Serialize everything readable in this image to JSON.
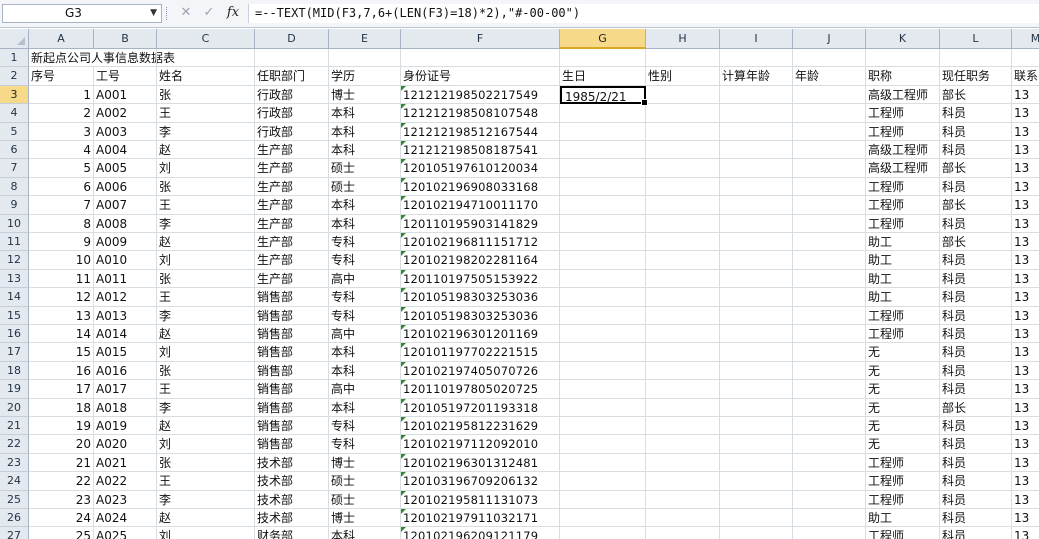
{
  "formula_bar": {
    "name_box": "G3",
    "formula": "=--TEXT(MID(F3,7,6+(LEN(F3)=18)*2),\"#-00-00\")"
  },
  "columns": [
    "A",
    "B",
    "C",
    "D",
    "E",
    "F",
    "G",
    "H",
    "I",
    "J",
    "K",
    "L",
    "M"
  ],
  "selected_column": "G",
  "row1_title": "新起点公司人事信息数据表",
  "headers": [
    "序号",
    "工号",
    "姓名",
    "任职部门",
    "学历",
    "身份证号",
    "生日",
    "性别",
    "计算年龄",
    "年龄",
    "职称",
    "现任职务",
    "联系"
  ],
  "active_cell_value": "1985/2/21",
  "rows": [
    {
      "r": "3",
      "seq": "1",
      "id": "A001",
      "name": "张",
      "dept": "行政部",
      "edu": "博士",
      "idno": "121212198502217549",
      "title": "高级工程师",
      "pos": "部长",
      "tel": "13"
    },
    {
      "r": "4",
      "seq": "2",
      "id": "A002",
      "name": "王",
      "dept": "行政部",
      "edu": "本科",
      "idno": "121212198508107548",
      "title": "工程师",
      "pos": "科员",
      "tel": "13"
    },
    {
      "r": "5",
      "seq": "3",
      "id": "A003",
      "name": "李",
      "dept": "行政部",
      "edu": "本科",
      "idno": "121212198512167544",
      "title": "工程师",
      "pos": "科员",
      "tel": "13"
    },
    {
      "r": "6",
      "seq": "4",
      "id": "A004",
      "name": "赵",
      "dept": "生产部",
      "edu": "本科",
      "idno": "121212198508187541",
      "title": "高级工程师",
      "pos": "科员",
      "tel": "13"
    },
    {
      "r": "7",
      "seq": "5",
      "id": "A005",
      "name": "刘",
      "dept": "生产部",
      "edu": "硕士",
      "idno": "120105197610120034",
      "title": "高级工程师",
      "pos": "部长",
      "tel": "13"
    },
    {
      "r": "8",
      "seq": "6",
      "id": "A006",
      "name": "张",
      "dept": "生产部",
      "edu": "硕士",
      "idno": "120102196908033168",
      "title": "工程师",
      "pos": "科员",
      "tel": "13"
    },
    {
      "r": "9",
      "seq": "7",
      "id": "A007",
      "name": "王",
      "dept": "生产部",
      "edu": "本科",
      "idno": "120102194710011170",
      "title": "工程师",
      "pos": "部长",
      "tel": "13"
    },
    {
      "r": "10",
      "seq": "8",
      "id": "A008",
      "name": "李",
      "dept": "生产部",
      "edu": "本科",
      "idno": "120110195903141829",
      "title": "工程师",
      "pos": "科员",
      "tel": "13"
    },
    {
      "r": "11",
      "seq": "9",
      "id": "A009",
      "name": "赵",
      "dept": "生产部",
      "edu": "专科",
      "idno": "120102196811151712",
      "title": "助工",
      "pos": "部长",
      "tel": "13"
    },
    {
      "r": "12",
      "seq": "10",
      "id": "A010",
      "name": "刘",
      "dept": "生产部",
      "edu": "专科",
      "idno": "120102198202281164",
      "title": "助工",
      "pos": "科员",
      "tel": "13"
    },
    {
      "r": "13",
      "seq": "11",
      "id": "A011",
      "name": "张",
      "dept": "生产部",
      "edu": "高中",
      "idno": "120110197505153922",
      "title": "助工",
      "pos": "科员",
      "tel": "13"
    },
    {
      "r": "14",
      "seq": "12",
      "id": "A012",
      "name": "王",
      "dept": "销售部",
      "edu": "专科",
      "idno": "120105198303253036",
      "title": "助工",
      "pos": "科员",
      "tel": "13"
    },
    {
      "r": "15",
      "seq": "13",
      "id": "A013",
      "name": "李",
      "dept": "销售部",
      "edu": "专科",
      "idno": "120105198303253036",
      "title": "工程师",
      "pos": "科员",
      "tel": "13"
    },
    {
      "r": "16",
      "seq": "14",
      "id": "A014",
      "name": "赵",
      "dept": "销售部",
      "edu": "高中",
      "idno": "120102196301201169",
      "title": "工程师",
      "pos": "科员",
      "tel": "13"
    },
    {
      "r": "17",
      "seq": "15",
      "id": "A015",
      "name": "刘",
      "dept": "销售部",
      "edu": "本科",
      "idno": "120101197702221515",
      "title": "无",
      "pos": "科员",
      "tel": "13"
    },
    {
      "r": "18",
      "seq": "16",
      "id": "A016",
      "name": "张",
      "dept": "销售部",
      "edu": "本科",
      "idno": "120102197405070726",
      "title": "无",
      "pos": "科员",
      "tel": "13"
    },
    {
      "r": "19",
      "seq": "17",
      "id": "A017",
      "name": "王",
      "dept": "销售部",
      "edu": "高中",
      "idno": "120110197805020725",
      "title": "无",
      "pos": "科员",
      "tel": "13"
    },
    {
      "r": "20",
      "seq": "18",
      "id": "A018",
      "name": "李",
      "dept": "销售部",
      "edu": "本科",
      "idno": "120105197201193318",
      "title": "无",
      "pos": "部长",
      "tel": "13"
    },
    {
      "r": "21",
      "seq": "19",
      "id": "A019",
      "name": "赵",
      "dept": "销售部",
      "edu": "专科",
      "idno": "120102195812231629",
      "title": "无",
      "pos": "科员",
      "tel": "13"
    },
    {
      "r": "22",
      "seq": "20",
      "id": "A020",
      "name": "刘",
      "dept": "销售部",
      "edu": "专科",
      "idno": "120102197112092010",
      "title": "无",
      "pos": "科员",
      "tel": "13"
    },
    {
      "r": "23",
      "seq": "21",
      "id": "A021",
      "name": "张",
      "dept": "技术部",
      "edu": "博士",
      "idno": "120102196301312481",
      "title": "工程师",
      "pos": "科员",
      "tel": "13"
    },
    {
      "r": "24",
      "seq": "22",
      "id": "A022",
      "name": "王",
      "dept": "技术部",
      "edu": "硕士",
      "idno": "120103196709206132",
      "title": "工程师",
      "pos": "科员",
      "tel": "13"
    },
    {
      "r": "25",
      "seq": "23",
      "id": "A023",
      "name": "李",
      "dept": "技术部",
      "edu": "硕士",
      "idno": "120102195811131073",
      "title": "工程师",
      "pos": "科员",
      "tel": "13"
    },
    {
      "r": "26",
      "seq": "24",
      "id": "A024",
      "name": "赵",
      "dept": "技术部",
      "edu": "博士",
      "idno": "120102197911032171",
      "title": "助工",
      "pos": "科员",
      "tel": "13"
    },
    {
      "r": "27",
      "seq": "25",
      "id": "A025",
      "name": "刘",
      "dept": "财务部",
      "edu": "本科",
      "idno": "120102196209121179",
      "title": "工程师",
      "pos": "科员",
      "tel": "13"
    }
  ]
}
